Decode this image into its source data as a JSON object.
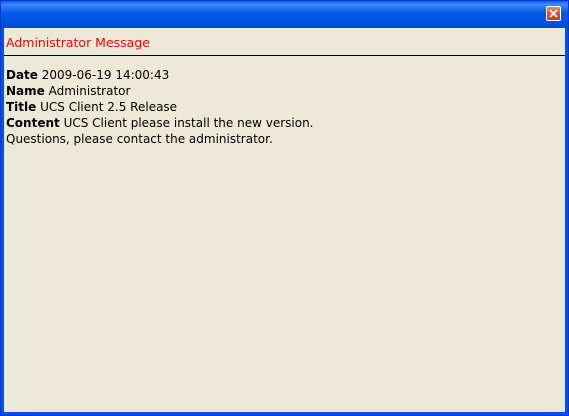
{
  "window": {
    "close_icon": "close-x-icon"
  },
  "message": {
    "heading": "Administrator Message",
    "fields": [
      {
        "label": "Date",
        "value": "2009-06-19 14:00:43"
      },
      {
        "label": "Name",
        "value": "Administrator"
      },
      {
        "label": "Title",
        "value": "UCS Client 2.5 Release"
      },
      {
        "label": "Content",
        "value": "UCS Client please install the new version."
      }
    ],
    "extra_line": "Questions, please contact the administrator."
  },
  "colors": {
    "titlebar": "#0054e3",
    "heading": "#ff0000",
    "client_bg": "#ece9d8",
    "close_button": "#d8512e"
  }
}
